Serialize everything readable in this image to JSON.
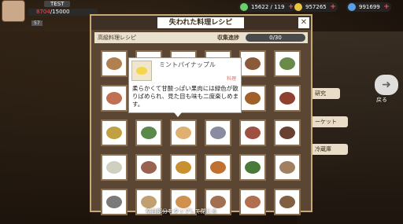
{
  "player": {
    "name": "TEST",
    "energy_current": "8704",
    "energy_total": "/15000",
    "level": "57"
  },
  "resources": [
    {
      "name": "stamina",
      "value": "15622 / 119",
      "color": "#6ad16a"
    },
    {
      "name": "coins",
      "value": "957265",
      "color": "#e8c440"
    },
    {
      "name": "gems",
      "value": "991699",
      "color": "#5aa0e8"
    }
  ],
  "modal": {
    "title": "失われた料理レシピ",
    "category": "高級料理レシピ",
    "progress_label": "収集進捗",
    "progress_value": "0/30",
    "close_icon": "close-icon"
  },
  "popup": {
    "name": "ミントパイナップル",
    "type": "料理",
    "description": "柔らかくて甘酸っぱい果肉には緑色が散りばめられ、見た目も味も二度楽しめます。"
  },
  "side": {
    "research": "研究",
    "back": "戻る",
    "market": "ーケット",
    "fridge": "冷蔵庫"
  },
  "footer_hint": "空白部分をタップして閉じる",
  "dishes": [
    "#b08050",
    "#c9a070",
    "#a06030",
    "#d0b080",
    "#8a5a3a",
    "#6a8a4a",
    "#c07050",
    "#d8b060",
    "#b0b0a0",
    "#7a9a5a",
    "#a0602a",
    "#904030",
    "#c0a040",
    "#5a8a4a",
    "#e0b070",
    "#8a8aa0",
    "#a05040",
    "#6a4030",
    "#d0d0c0",
    "#9a6050",
    "#c89030",
    "#c07030",
    "#4a7a3a",
    "#a08060",
    "#7a7a7a",
    "#c0a070",
    "#d09050",
    "#a07050",
    "#b07050",
    "#806040"
  ]
}
